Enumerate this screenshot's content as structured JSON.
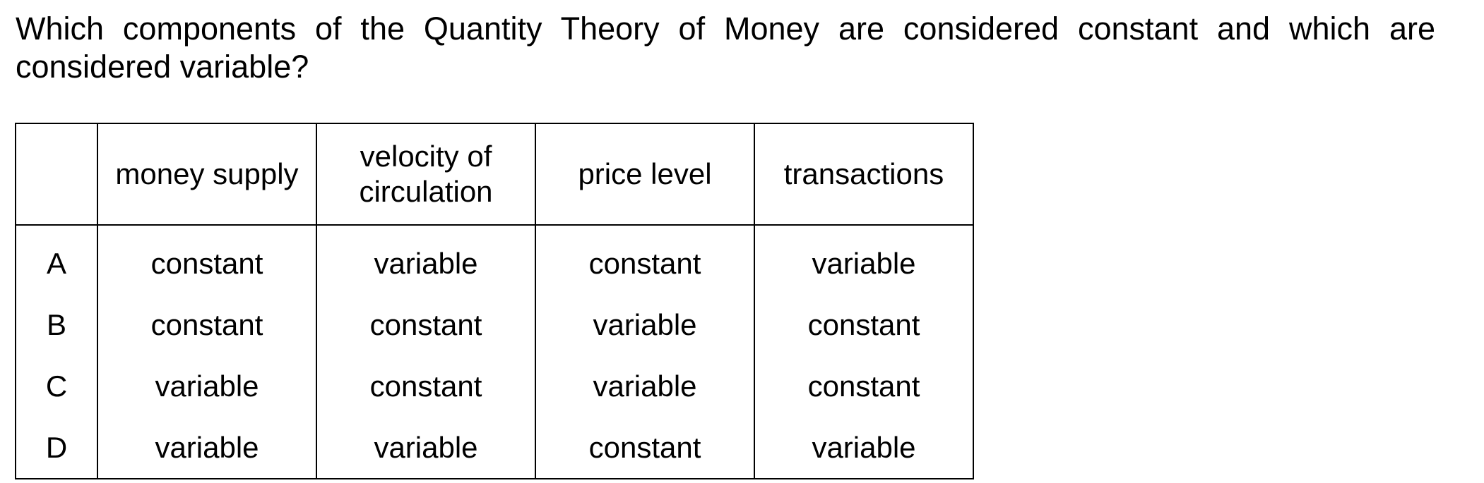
{
  "question": {
    "text": "Which components of the Quantity Theory of Money are considered constant and which are considered variable?"
  },
  "table": {
    "headers": [
      "",
      "money supply",
      "velocity of circulation",
      "price level",
      "transactions"
    ],
    "rows": [
      {
        "key": "A",
        "cells": [
          "constant",
          "variable",
          "constant",
          "variable"
        ]
      },
      {
        "key": "B",
        "cells": [
          "constant",
          "constant",
          "variable",
          "constant"
        ]
      },
      {
        "key": "C",
        "cells": [
          "variable",
          "constant",
          "variable",
          "constant"
        ]
      },
      {
        "key": "D",
        "cells": [
          "variable",
          "variable",
          "constant",
          "variable"
        ]
      }
    ]
  }
}
